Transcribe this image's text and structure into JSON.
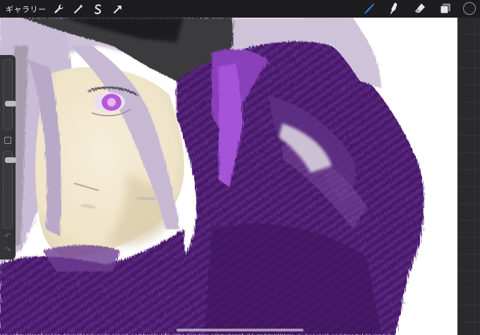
{
  "toolbar": {
    "gallery_label": "ギャラリー",
    "left_tools": [
      {
        "name": "wrench-icon"
      },
      {
        "name": "magic-wand-icon"
      },
      {
        "name": "selection-icon"
      },
      {
        "name": "transform-arrow-icon"
      }
    ],
    "right_tools": [
      {
        "name": "brush-icon",
        "active": true
      },
      {
        "name": "smudge-icon",
        "active": false
      },
      {
        "name": "eraser-icon",
        "active": false
      },
      {
        "name": "layers-icon",
        "active": false
      }
    ],
    "current_color": "#1f1f21"
  },
  "colors": {
    "active_tool": "#2f7cf6",
    "toolbar_bg": "#1d1d1f",
    "icon": "#e8e8ea",
    "purple_dark": "#4a1d6b",
    "purple_mid": "#5f2a86",
    "lavender": "#cdbfd8",
    "skin": "#f3ead6"
  },
  "sidebar": {
    "undo_symbol": "↶",
    "redo_symbol": "↷"
  }
}
